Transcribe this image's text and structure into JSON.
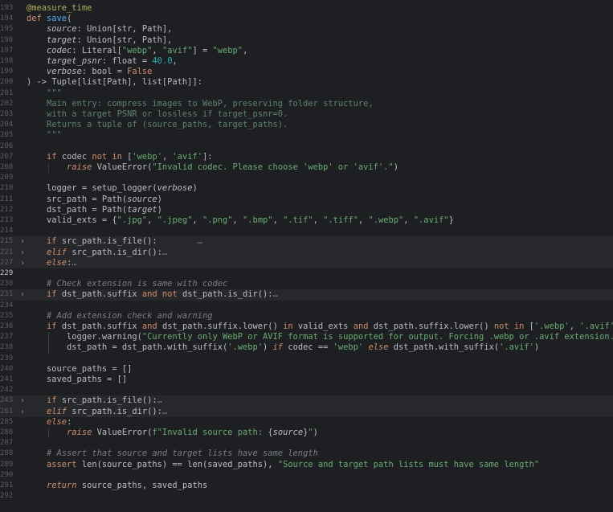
{
  "editor": {
    "lines": [
      {
        "n": "193",
        "t": [
          [
            "deco",
            "@measure_time"
          ]
        ]
      },
      {
        "n": "194",
        "t": [
          [
            "kw",
            "def "
          ],
          [
            "fn",
            "save"
          ],
          [
            "",
            "("
          ]
        ]
      },
      {
        "n": "195",
        "t": [
          [
            "",
            "    "
          ],
          [
            "param",
            "source"
          ],
          [
            "",
            ": "
          ],
          [
            "",
            "Union[str, Path],"
          ]
        ]
      },
      {
        "n": "196",
        "t": [
          [
            "",
            "    "
          ],
          [
            "param",
            "target"
          ],
          [
            "",
            ": "
          ],
          [
            "",
            "Union[str, Path],"
          ]
        ]
      },
      {
        "n": "197",
        "t": [
          [
            "",
            "    "
          ],
          [
            "param",
            "codec"
          ],
          [
            "",
            ": Literal["
          ],
          [
            "str",
            "\"webp\""
          ],
          [
            "",
            ", "
          ],
          [
            "str",
            "\"avif\""
          ],
          [
            "",
            "] = "
          ],
          [
            "str",
            "\"webp\""
          ],
          [
            "",
            ","
          ]
        ]
      },
      {
        "n": "198",
        "t": [
          [
            "",
            "    "
          ],
          [
            "param",
            "target_psnr"
          ],
          [
            "",
            ": float = "
          ],
          [
            "num",
            "40.0"
          ],
          [
            "",
            ","
          ]
        ]
      },
      {
        "n": "199",
        "t": [
          [
            "",
            "    "
          ],
          [
            "param",
            "verbose"
          ],
          [
            "",
            ": bool = "
          ],
          [
            "kw",
            "False"
          ]
        ]
      },
      {
        "n": "200",
        "t": [
          [
            "",
            ") -> Tuple[list[Path], list[Path]]:"
          ]
        ]
      },
      {
        "n": "201",
        "t": [
          [
            "doc",
            "    \"\"\""
          ]
        ]
      },
      {
        "n": "202",
        "t": [
          [
            "doc",
            "    Main entry: compress images to WebP, preserving folder structure,"
          ]
        ]
      },
      {
        "n": "203",
        "t": [
          [
            "doc",
            "    with a target PSNR or lossless if target_psnr=0."
          ]
        ]
      },
      {
        "n": "204",
        "t": [
          [
            "doc",
            "    Returns a tuple of (source_paths, target_paths)."
          ]
        ]
      },
      {
        "n": "205",
        "t": [
          [
            "doc",
            "    \"\"\""
          ]
        ]
      },
      {
        "n": "206",
        "t": []
      },
      {
        "n": "207",
        "t": [
          [
            "",
            "    "
          ],
          [
            "kw",
            "if "
          ],
          [
            "",
            "codec "
          ],
          [
            "kw",
            "not in "
          ],
          [
            "",
            "["
          ],
          [
            "str",
            "'webp'"
          ],
          [
            "",
            ", "
          ],
          [
            "str",
            "'avif'"
          ],
          [
            "",
            "]:"
          ]
        ]
      },
      {
        "n": "208",
        "t": [
          [
            "",
            "        "
          ],
          [
            "kwi",
            "raise "
          ],
          [
            "",
            "ValueError("
          ],
          [
            "str",
            "\"Invalid codec. Please choose 'webp' or 'avif'.\""
          ],
          [
            "",
            ")"
          ]
        ]
      },
      {
        "n": "209",
        "t": []
      },
      {
        "n": "210",
        "t": [
          [
            "",
            "    logger = setup_logger("
          ],
          [
            "param",
            "verbose"
          ],
          [
            "",
            ")"
          ]
        ]
      },
      {
        "n": "211",
        "t": [
          [
            "",
            "    src_path = Path("
          ],
          [
            "param",
            "source"
          ],
          [
            "",
            ")"
          ]
        ]
      },
      {
        "n": "212",
        "t": [
          [
            "",
            "    dst_path = Path("
          ],
          [
            "param",
            "target"
          ],
          [
            "",
            ")"
          ]
        ]
      },
      {
        "n": "213",
        "t": [
          [
            "",
            "    valid_exts = {"
          ],
          [
            "str",
            "\".jpg\""
          ],
          [
            "",
            ", "
          ],
          [
            "str",
            "\".jpeg\""
          ],
          [
            "",
            ", "
          ],
          [
            "str",
            "\".png\""
          ],
          [
            "",
            ", "
          ],
          [
            "str",
            "\".bmp\""
          ],
          [
            "",
            ", "
          ],
          [
            "str",
            "\".tif\""
          ],
          [
            "",
            ", "
          ],
          [
            "str",
            "\".tiff\""
          ],
          [
            "",
            ", "
          ],
          [
            "str",
            "\".webp\""
          ],
          [
            "",
            ", "
          ],
          [
            "str",
            "\".avif\""
          ],
          [
            "",
            "}"
          ]
        ]
      },
      {
        "n": "214",
        "t": []
      },
      {
        "n": "215",
        "fold": true,
        "t": [
          [
            "",
            "    "
          ],
          [
            "kw",
            "if "
          ],
          [
            "",
            "src_path.is_file():"
          ],
          [
            "ell",
            "        …"
          ]
        ]
      },
      {
        "n": "221",
        "fold": true,
        "t": [
          [
            "",
            "    "
          ],
          [
            "kwi",
            "elif "
          ],
          [
            "",
            "src_path.is_dir():"
          ],
          [
            "ell",
            "…"
          ]
        ]
      },
      {
        "n": "227",
        "fold": true,
        "t": [
          [
            "",
            "    "
          ],
          [
            "kwi",
            "else"
          ],
          [
            "",
            ":"
          ],
          [
            "ell",
            "…"
          ]
        ]
      },
      {
        "n": "229",
        "active": true,
        "t": []
      },
      {
        "n": "230",
        "t": [
          [
            "cmt",
            "    # Check extension is same with codec"
          ]
        ]
      },
      {
        "n": "231",
        "fold": true,
        "t": [
          [
            "",
            "    "
          ],
          [
            "kw",
            "if "
          ],
          [
            "",
            "dst_path.suffix "
          ],
          [
            "kw",
            "and not "
          ],
          [
            "",
            "dst_path.is_dir():"
          ],
          [
            "ell",
            "…"
          ]
        ]
      },
      {
        "n": "234",
        "t": []
      },
      {
        "n": "235",
        "t": [
          [
            "cmt",
            "    # Add extension check and warning"
          ]
        ]
      },
      {
        "n": "236",
        "t": [
          [
            "",
            "    "
          ],
          [
            "kw",
            "if "
          ],
          [
            "",
            "dst_path.suffix "
          ],
          [
            "kw",
            "and "
          ],
          [
            "",
            "dst_path.suffix.lower() "
          ],
          [
            "kw",
            "in "
          ],
          [
            "",
            "valid_exts "
          ],
          [
            "kw",
            "and "
          ],
          [
            "",
            "dst_path.suffix.lower() "
          ],
          [
            "kw",
            "not in "
          ],
          [
            "",
            "["
          ],
          [
            "str",
            "'.webp'"
          ],
          [
            "",
            ", "
          ],
          [
            "str",
            "'.avif'"
          ],
          [
            "",
            "]:"
          ]
        ]
      },
      {
        "n": "237",
        "t": [
          [
            "",
            "        logger.warning("
          ],
          [
            "str",
            "\"Currently only WebP or AVIF format is supported for output. Forcing .webp or .avif extension.\""
          ],
          [
            "",
            ")"
          ]
        ]
      },
      {
        "n": "238",
        "t": [
          [
            "",
            "        dst_path = dst_path.with_suffix("
          ],
          [
            "str",
            "'.webp'"
          ],
          [
            "",
            ") "
          ],
          [
            "kwi",
            "if "
          ],
          [
            "",
            "codec == "
          ],
          [
            "str",
            "'webp' "
          ],
          [
            "kwi",
            "else "
          ],
          [
            "",
            "dst_path.with_suffix("
          ],
          [
            "str",
            "'.avif'"
          ],
          [
            "",
            ")"
          ]
        ]
      },
      {
        "n": "239",
        "t": []
      },
      {
        "n": "240",
        "t": [
          [
            "",
            "    source_paths = []"
          ]
        ]
      },
      {
        "n": "241",
        "t": [
          [
            "",
            "    saved_paths = []"
          ]
        ]
      },
      {
        "n": "242",
        "t": []
      },
      {
        "n": "243",
        "fold": true,
        "t": [
          [
            "",
            "    "
          ],
          [
            "kw",
            "if "
          ],
          [
            "",
            "src_path.is_file():"
          ],
          [
            "ell",
            "…"
          ]
        ]
      },
      {
        "n": "261",
        "fold": true,
        "t": [
          [
            "",
            "    "
          ],
          [
            "kwi",
            "elif "
          ],
          [
            "",
            "src_path.is_dir():"
          ],
          [
            "ell",
            "…"
          ]
        ]
      },
      {
        "n": "285",
        "t": [
          [
            "",
            "    "
          ],
          [
            "kwi",
            "else"
          ],
          [
            "",
            ":"
          ]
        ]
      },
      {
        "n": "286",
        "t": [
          [
            "",
            "        "
          ],
          [
            "kwi",
            "raise "
          ],
          [
            "",
            "ValueError("
          ],
          [
            "str",
            "f\"Invalid source path: "
          ],
          [
            "",
            "{"
          ],
          [
            "param",
            "source"
          ],
          [
            "",
            "}"
          ],
          [
            "str",
            "\""
          ],
          [
            "",
            ")"
          ]
        ]
      },
      {
        "n": "287",
        "t": []
      },
      {
        "n": "288",
        "t": [
          [
            "cmt",
            "    # Assert that source and target lists have same length"
          ]
        ]
      },
      {
        "n": "289",
        "t": [
          [
            "",
            "    "
          ],
          [
            "kw",
            "assert "
          ],
          [
            "",
            "len(source_paths) == len(saved_paths), "
          ],
          [
            "str",
            "\"Source and target path lists must have same length\""
          ]
        ]
      },
      {
        "n": "290",
        "t": []
      },
      {
        "n": "291",
        "t": [
          [
            "",
            "    "
          ],
          [
            "kwi",
            "return "
          ],
          [
            "",
            "source_paths, saved_paths"
          ]
        ]
      },
      {
        "n": "292",
        "t": []
      }
    ]
  }
}
